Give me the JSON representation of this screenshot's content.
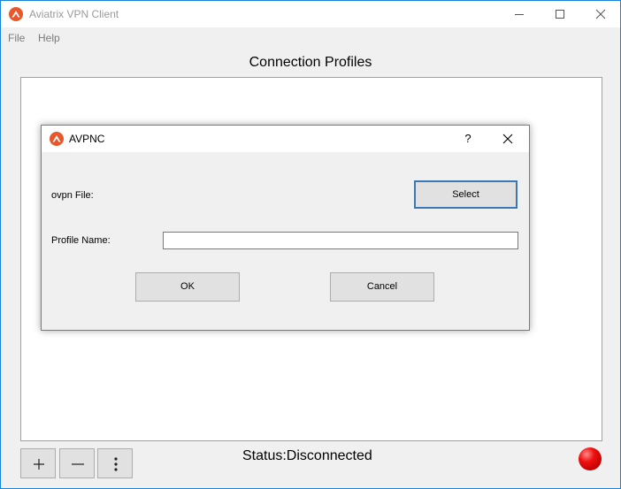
{
  "window": {
    "title": "Aviatrix VPN Client",
    "menu": [
      "File",
      "Help"
    ]
  },
  "main": {
    "heading": "Connection Profiles",
    "toolbar": {
      "add_icon": "plus-icon",
      "remove_icon": "minus-icon",
      "more_icon": "vertical-ellipsis-icon"
    },
    "status": "Status:Disconnected",
    "status_color": "#e01010"
  },
  "dialog": {
    "title": "AVPNC",
    "help_label": "?",
    "ovpn_label": "ovpn File:",
    "select_label": "Select",
    "profile_name_label": "Profile Name:",
    "profile_name_value": "",
    "ok_label": "OK",
    "cancel_label": "Cancel"
  },
  "colors": {
    "brand": "#e8572b",
    "window_border": "#1883d7",
    "default_button_border": "#3c78b5"
  }
}
